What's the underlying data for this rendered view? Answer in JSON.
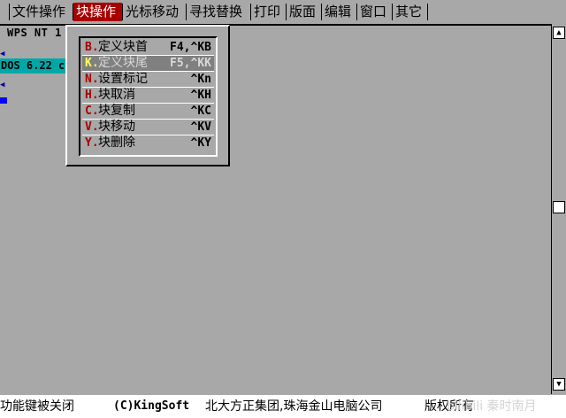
{
  "menubar": {
    "items": [
      {
        "label": "文件操作"
      },
      {
        "label": "块操作"
      },
      {
        "label": "光标移动"
      },
      {
        "label": "寻找替换"
      },
      {
        "label": "打印"
      },
      {
        "label": "版面"
      },
      {
        "label": "编辑"
      },
      {
        "label": "窗口"
      },
      {
        "label": "其它"
      }
    ]
  },
  "document": {
    "title": "WPS NT 1",
    "dos_line": "DOS 6.22 c"
  },
  "dropdown": {
    "items": [
      {
        "key": "B.",
        "label": "定义块首",
        "shortcut": "F4,^KB"
      },
      {
        "key": "K.",
        "label": "定义块尾",
        "shortcut": "F5,^KK"
      },
      {
        "key": "N.",
        "label": "设置标记",
        "shortcut": "^Kn"
      },
      {
        "key": "H.",
        "label": "块取消",
        "shortcut": "^KH"
      },
      {
        "key": "C.",
        "label": "块复制",
        "shortcut": "^KC"
      },
      {
        "key": "V.",
        "label": "块移动",
        "shortcut": "^KV"
      },
      {
        "key": "Y.",
        "label": "块删除",
        "shortcut": "^KY"
      }
    ]
  },
  "scrollbar": {
    "up_arrow": "▲",
    "down_arrow": "▼"
  },
  "statusbar": {
    "fn_keys": "功能键被关闭",
    "copyright": "(C)KingSoft",
    "company": "北大方正集团,珠海金山电脑公司",
    "version": "版权所有"
  },
  "watermark": "bilibili 秦时南月",
  "colors": {
    "desktop": "#a8a8a8",
    "active_menu": "#a80000",
    "hotkey": "#a80000",
    "dos_bar": "#00a8a8",
    "marker": "#0000a8"
  }
}
